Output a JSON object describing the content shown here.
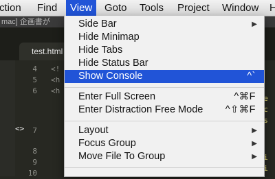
{
  "menubar": {
    "items": [
      "ction",
      "Find",
      "View",
      "Goto",
      "Tools",
      "Project",
      "Window",
      "H"
    ]
  },
  "window": {
    "title_fragment": "mac] 企画書が",
    "tab_label": "test.html"
  },
  "editor": {
    "line_numbers": [
      "4",
      "5",
      "6",
      "7",
      "8",
      "9",
      "10"
    ],
    "code_lines": [
      "<!",
      "<h",
      "<h"
    ],
    "right_fragments": [
      "\"te",
      "\"ic",
      "ass",
      "t\"",
      "e.",
      "ili",
      "ili"
    ],
    "fold_marker": "<>"
  },
  "view_menu": {
    "items": [
      {
        "label": "Side Bar",
        "shortcut": "",
        "submenu": true
      },
      {
        "label": "Hide Minimap",
        "shortcut": "",
        "submenu": false
      },
      {
        "label": "Hide Tabs",
        "shortcut": "",
        "submenu": false
      },
      {
        "label": "Hide Status Bar",
        "shortcut": "",
        "submenu": false
      },
      {
        "label": "Show Console",
        "shortcut": "^`",
        "submenu": false,
        "highlighted": true
      },
      {
        "label": "Enter Full Screen",
        "shortcut": "^⌘F",
        "submenu": false
      },
      {
        "label": "Enter Distraction Free Mode",
        "shortcut": "^⇧⌘F",
        "submenu": false
      },
      {
        "label": "Layout",
        "shortcut": "",
        "submenu": true
      },
      {
        "label": "Focus Group",
        "shortcut": "",
        "submenu": true
      },
      {
        "label": "Move File To Group",
        "shortcut": "",
        "submenu": true
      }
    ],
    "submenu_arrow": "▶",
    "highlight_color": "#2154d7"
  }
}
